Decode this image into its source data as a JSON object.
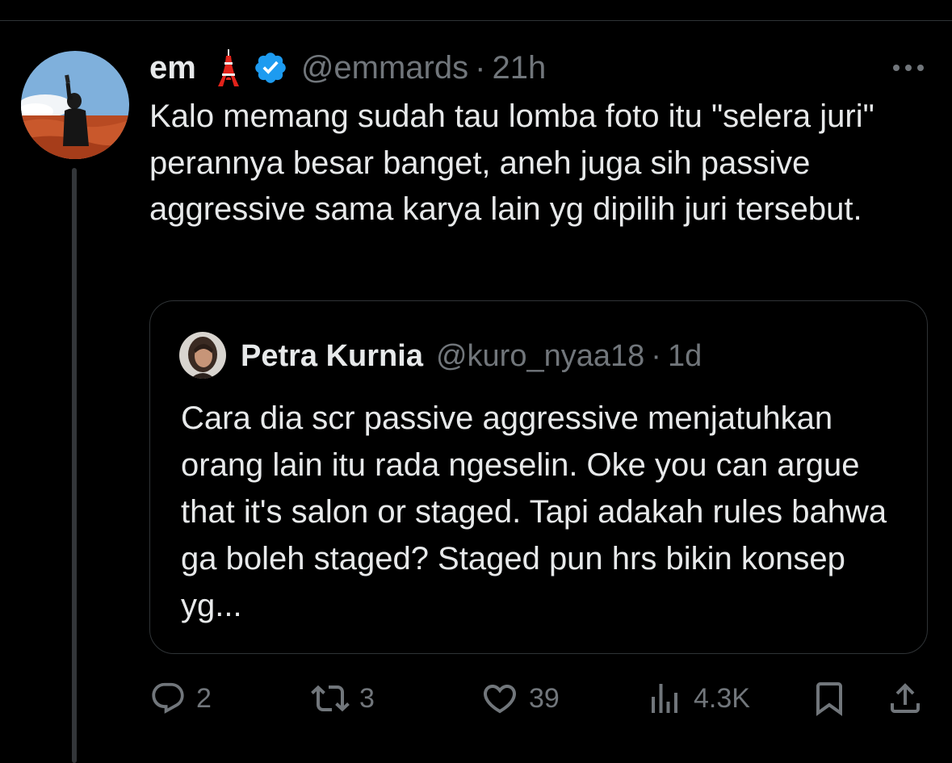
{
  "tweet": {
    "author_name": "em",
    "author_handle": "@emmards",
    "separator": "·",
    "time": "21h",
    "text": "Kalo memang sudah tau lomba foto itu \"selera juri\" perannya besar banget, aneh juga sih passive aggressive sama karya lain yg dipilih juri tersebut.",
    "name_emoji": "tokyo-tower-emoji",
    "verified": true,
    "accent_color": "#1d9bf0"
  },
  "quoted_tweet": {
    "author_name": "Petra Kurnia",
    "author_handle": "@kuro_nyaa18",
    "separator": "·",
    "time": "1d",
    "text": "Cara dia scr passive aggressive menjatuhkan orang lain itu rada ngeselin. Oke you can argue that it's salon or staged. Tapi adakah rules bahwa ga boleh staged? Staged pun hrs bikin konsep yg..."
  },
  "actions": {
    "replies": "2",
    "retweets": "3",
    "likes": "39",
    "views": "4.3K"
  },
  "colors": {
    "background": "#000000",
    "text_primary": "#e7e9ea",
    "text_secondary": "#71767b",
    "border": "#2f3336"
  }
}
